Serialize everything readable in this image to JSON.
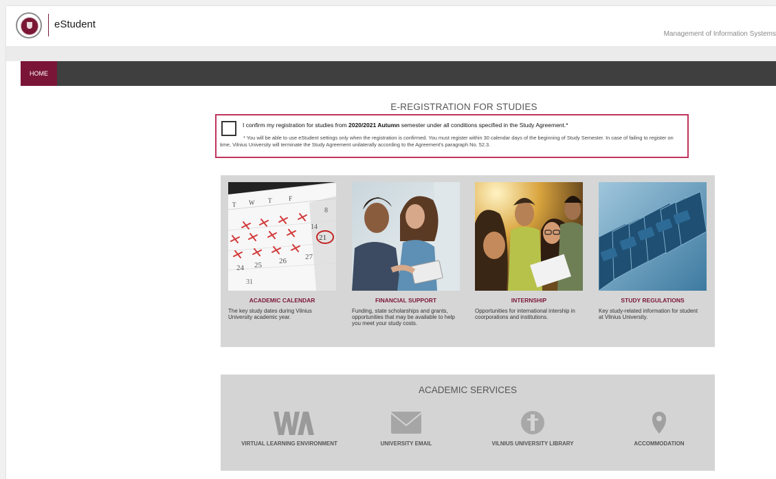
{
  "header": {
    "app_name": "eStudent",
    "system_label": "Management of Information Systems"
  },
  "nav": {
    "home_label": "HOME"
  },
  "registration": {
    "title": "E-REGISTRATION FOR STUDIES",
    "confirm_prefix": "I confirm my registration for studies from ",
    "confirm_bold": "2020/2021 Autumn",
    "confirm_suffix": " semester under all conditions specified in the Study Agreement.*",
    "note": "* You will be able to use eStudent settings only when the registration is confirmed. You must register within 30 calendar days of the beginning of Study Semester. In case of failing to register on time, Vilnius University will terminate the Study Agreement unilaterally according to the Agreement's paragraph No. 52.3."
  },
  "cards": [
    {
      "title": "ACADEMIC CALENDAR",
      "desc": "The key study dates during Vilnius University academic year."
    },
    {
      "title": "FINANCIAL SUPPORT",
      "desc": "Funding, state scholarships and grants, opportunities that may be available to help you meet your study costs."
    },
    {
      "title": "INTERNSHIP",
      "desc": "Opportunities for international intership in coorporations and institutions."
    },
    {
      "title": "STUDY REGULATIONS",
      "desc": "Key study-related information for student at Vilnius University."
    }
  ],
  "calendar_image": {
    "weekday_letters": [
      "T",
      "W",
      "T",
      "F"
    ],
    "numbers": [
      "14",
      "21",
      "25",
      "26",
      "27",
      "24",
      "31",
      "8"
    ]
  },
  "services": {
    "title": "ACADEMIC SERVICES",
    "items": [
      {
        "label": "VIRTUAL LEARNING ENVIRONMENT",
        "icon": "vle-logo-icon"
      },
      {
        "label": "UNIVERSITY EMAIL",
        "icon": "envelope-icon"
      },
      {
        "label": "VILNIUS UNIVERSITY LIBRARY",
        "icon": "library-icon"
      },
      {
        "label": "ACCOMMODATION",
        "icon": "location-pin-icon"
      }
    ]
  },
  "colors": {
    "brand": "#7b1537",
    "nav_bg": "#3f3f3f",
    "highlight_border": "#c0325a",
    "panel_bg": "#d6d6d6"
  }
}
